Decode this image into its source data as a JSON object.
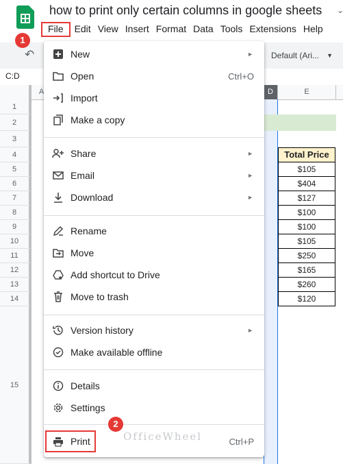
{
  "window": {
    "doc_title": "how to print only certain columns in google sheets",
    "menu_bar": [
      "File",
      "Edit",
      "View",
      "Insert",
      "Format",
      "Data",
      "Tools",
      "Extensions",
      "Help"
    ]
  },
  "toolbar": {
    "font": "Default (Ari..."
  },
  "name_box": "C:D",
  "columns": [
    "A",
    "D",
    "E"
  ],
  "rows": [
    "1",
    "2",
    "3",
    "4",
    "5",
    "6",
    "7",
    "8",
    "9",
    "10",
    "11",
    "12",
    "13",
    "14",
    "15"
  ],
  "table": {
    "header": "Total Price",
    "values": [
      "$105",
      "$404",
      "$127",
      "$100",
      "$100",
      "$105",
      "$250",
      "$165",
      "$260",
      "$120"
    ]
  },
  "file_menu": {
    "items": [
      {
        "label": "New",
        "icon": "plus-square-icon"
      },
      {
        "label": "Open",
        "icon": "folder-icon",
        "shortcut": "Ctrl+O"
      },
      {
        "label": "Import",
        "icon": "import-icon"
      },
      {
        "label": "Make a copy",
        "icon": "copy-icon"
      },
      {
        "label": "Share",
        "icon": "person-add-icon"
      },
      {
        "label": "Email",
        "icon": "email-icon"
      },
      {
        "label": "Download",
        "icon": "download-icon"
      },
      {
        "label": "Rename",
        "icon": "rename-icon"
      },
      {
        "label": "Move",
        "icon": "move-icon"
      },
      {
        "label": "Add shortcut to Drive",
        "icon": "drive-shortcut-icon"
      },
      {
        "label": "Move to trash",
        "icon": "trash-icon"
      },
      {
        "label": "Version history",
        "icon": "history-icon"
      },
      {
        "label": "Make available offline",
        "icon": "offline-icon"
      },
      {
        "label": "Details",
        "icon": "info-icon"
      },
      {
        "label": "Settings",
        "icon": "gear-icon"
      },
      {
        "label": "Print",
        "icon": "printer-icon",
        "shortcut": "Ctrl+P"
      }
    ]
  },
  "annotations": {
    "step1": "1",
    "step2": "2"
  },
  "watermark": "OfficeWheel",
  "colors": {
    "annotation_red": "#e53935",
    "header_fill": "#fff2cc",
    "sheets_green": "#0f9d58"
  }
}
